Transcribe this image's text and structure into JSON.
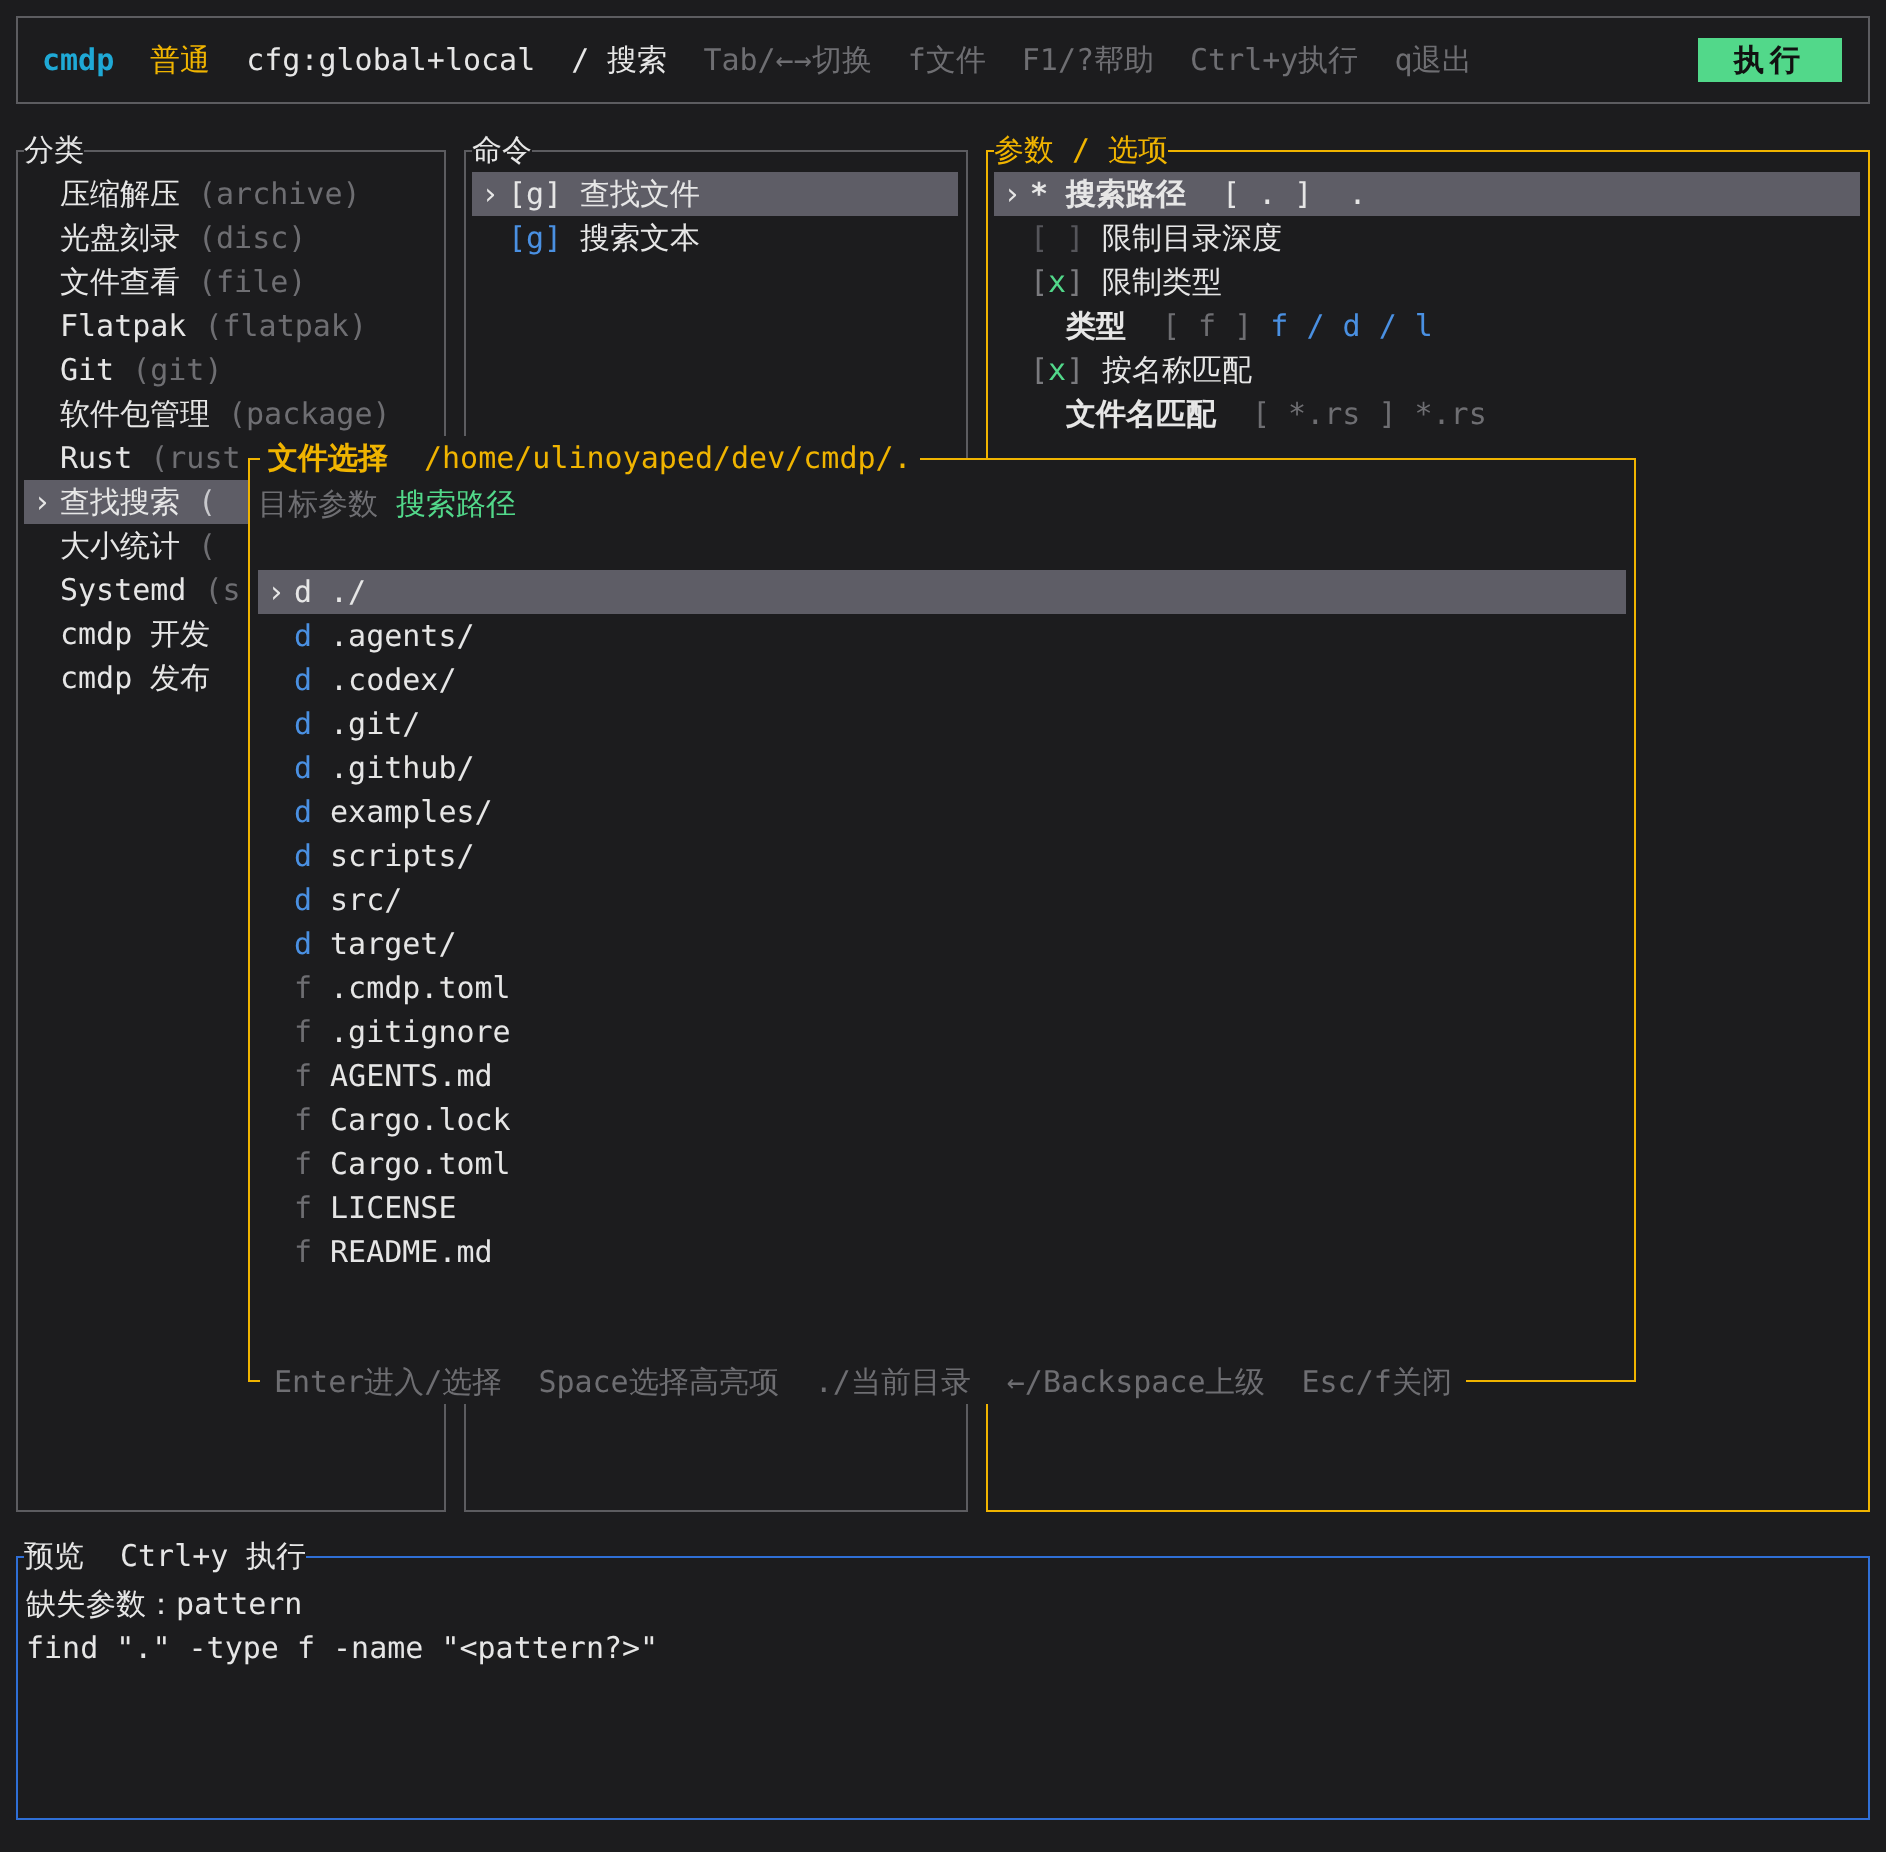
{
  "top_bar": {
    "items": [
      {
        "kind": "brand",
        "text": "cmdp"
      },
      {
        "kind": "mode",
        "text": "普通"
      },
      {
        "kind": "info",
        "text": "cfg:global+local"
      },
      {
        "kind": "info",
        "text": "/ 搜索"
      },
      {
        "kind": "hint",
        "text": "Tab/←→切换"
      },
      {
        "kind": "hint",
        "text": "f文件"
      },
      {
        "kind": "hint",
        "text": "F1/?帮助"
      },
      {
        "kind": "hint",
        "text": "Ctrl+y执行"
      },
      {
        "kind": "hint",
        "text": "q退出"
      },
      {
        "kind": "button",
        "text": "执行"
      }
    ]
  },
  "categories": {
    "title": "分类",
    "items": [
      {
        "name": "压缩解压",
        "hint": "(archive)",
        "selected": false
      },
      {
        "name": "光盘刻录",
        "hint": "(disc)",
        "selected": false
      },
      {
        "name": "文件查看",
        "hint": "(file)",
        "selected": false
      },
      {
        "name": "Flatpak",
        "hint": "(flatpak)",
        "selected": false
      },
      {
        "name": "Git",
        "hint": "(git)",
        "selected": false
      },
      {
        "name": "软件包管理",
        "hint": "(package)",
        "selected": false
      },
      {
        "name": "Rust",
        "hint": "(rust",
        "selected": false
      },
      {
        "name": "查找搜索",
        "hint": "(",
        "selected": true,
        "cursor": "›"
      },
      {
        "name": "大小统计",
        "hint": "(",
        "selected": false
      },
      {
        "name": "Systemd",
        "hint": "(s",
        "selected": false
      },
      {
        "name": "cmdp 开发",
        "selected": false
      },
      {
        "name": "cmdp 发布",
        "selected": false
      }
    ]
  },
  "commands": {
    "title": "命令",
    "items": [
      {
        "key": "[g]",
        "label": "查找文件",
        "selected": true,
        "cursor": "›"
      },
      {
        "key": "[g]",
        "label": "搜索文本",
        "selected": false
      }
    ]
  },
  "params": {
    "title": "参数 / 选项",
    "items": [
      {
        "kind": "field",
        "marker": "*",
        "label": "搜索路径",
        "value": "[ . ]",
        "current": ".",
        "selected": true,
        "cursor": "›"
      },
      {
        "kind": "toggle",
        "box": "[ ]",
        "label": "限制目录深度",
        "checked": false,
        "selected": false
      },
      {
        "kind": "toggle",
        "box": "[x]",
        "label": "限制类型",
        "checked": true,
        "selected": false
      },
      {
        "kind": "choice",
        "label": "类型",
        "value": "[ f ]",
        "options": "f / d / l",
        "selected": false
      },
      {
        "kind": "toggle",
        "box": "[x]",
        "label": "按名称匹配",
        "checked": true,
        "selected": false
      },
      {
        "kind": "input",
        "label": "文件名匹配",
        "value": "[ *.rs ]",
        "placeholder": "*.rs",
        "selected": false
      }
    ]
  },
  "file_picker": {
    "title": "文件选择",
    "path": "/home/ulinoyaped/dev/cmdp/.",
    "target_label": "目标参数",
    "target": "搜索路径",
    "files": [
      {
        "type": "d",
        "name": "./",
        "selected": true,
        "cursor": "›"
      },
      {
        "type": "d",
        "name": ".agents/",
        "selected": false
      },
      {
        "type": "d",
        "name": ".codex/",
        "selected": false
      },
      {
        "type": "d",
        "name": ".git/",
        "selected": false
      },
      {
        "type": "d",
        "name": ".github/",
        "selected": false
      },
      {
        "type": "d",
        "name": "examples/",
        "selected": false
      },
      {
        "type": "d",
        "name": "scripts/",
        "selected": false
      },
      {
        "type": "d",
        "name": "src/",
        "selected": false
      },
      {
        "type": "d",
        "name": "target/",
        "selected": false
      },
      {
        "type": "f",
        "name": ".cmdp.toml",
        "selected": false
      },
      {
        "type": "f",
        "name": ".gitignore",
        "selected": false
      },
      {
        "type": "f",
        "name": "AGENTS.md",
        "selected": false
      },
      {
        "type": "f",
        "name": "Cargo.lock",
        "selected": false
      },
      {
        "type": "f",
        "name": "Cargo.toml",
        "selected": false
      },
      {
        "type": "f",
        "name": "LICENSE",
        "selected": false
      },
      {
        "type": "f",
        "name": "README.md",
        "selected": false
      }
    ],
    "hints": [
      "Enter进入/选择",
      "Space选择高亮项",
      "./当前目录",
      "←/Backspace上级",
      "Esc/f关闭"
    ]
  },
  "preview": {
    "title": "预览",
    "shortcut": "Ctrl+y 执行",
    "lines": [
      "缺失参数：pattern",
      "find \".\" -type f -name \"<pattern?>\""
    ]
  }
}
